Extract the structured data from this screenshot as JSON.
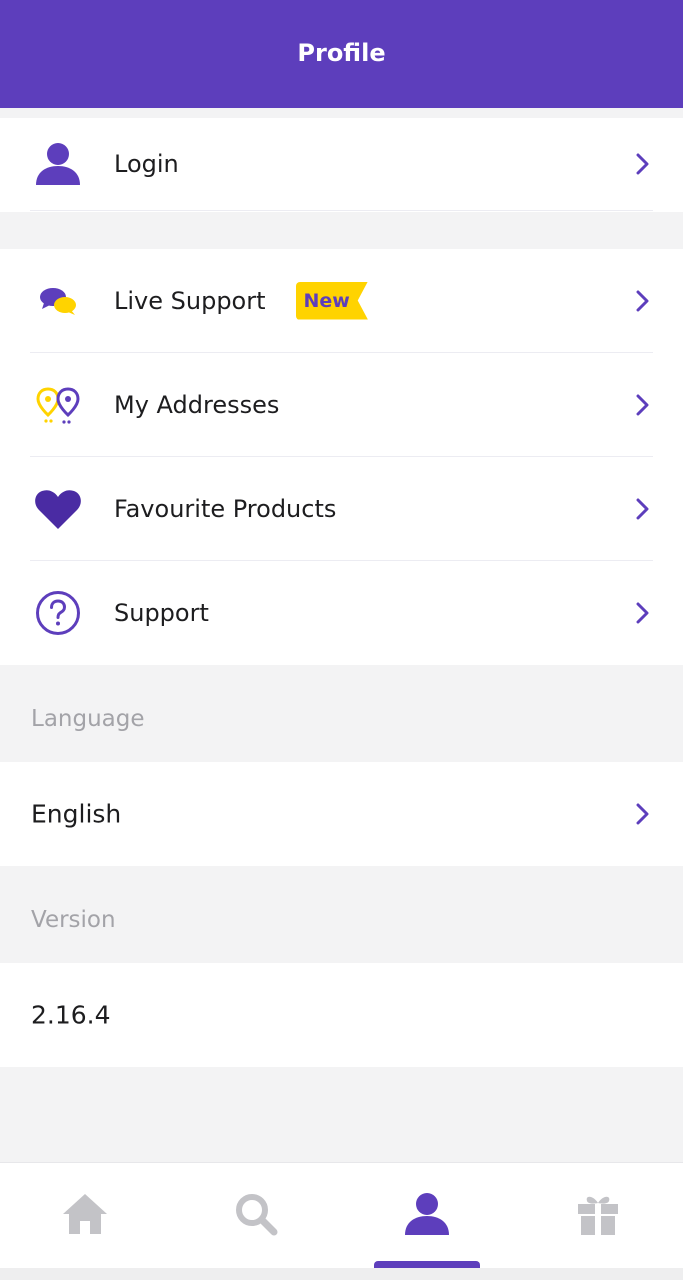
{
  "header": {
    "title": "Profile"
  },
  "account": {
    "login_label": "Login"
  },
  "menu": {
    "live_support": "Live Support",
    "live_support_badge": "New",
    "my_addresses": "My Addresses",
    "favourite_products": "Favourite Products",
    "support": "Support"
  },
  "language": {
    "section_label": "Language",
    "value": "English"
  },
  "version": {
    "section_label": "Version",
    "value": "2.16.4"
  },
  "tabbar": {
    "tabs": [
      {
        "icon": "home-icon",
        "active": false
      },
      {
        "icon": "search-icon",
        "active": false
      },
      {
        "icon": "profile-icon",
        "active": true
      },
      {
        "icon": "gift-icon",
        "active": false
      }
    ]
  },
  "colors": {
    "brand": "#5d3ebc",
    "accent": "#ffd300",
    "inactive_icon": "#c3c3c7"
  }
}
